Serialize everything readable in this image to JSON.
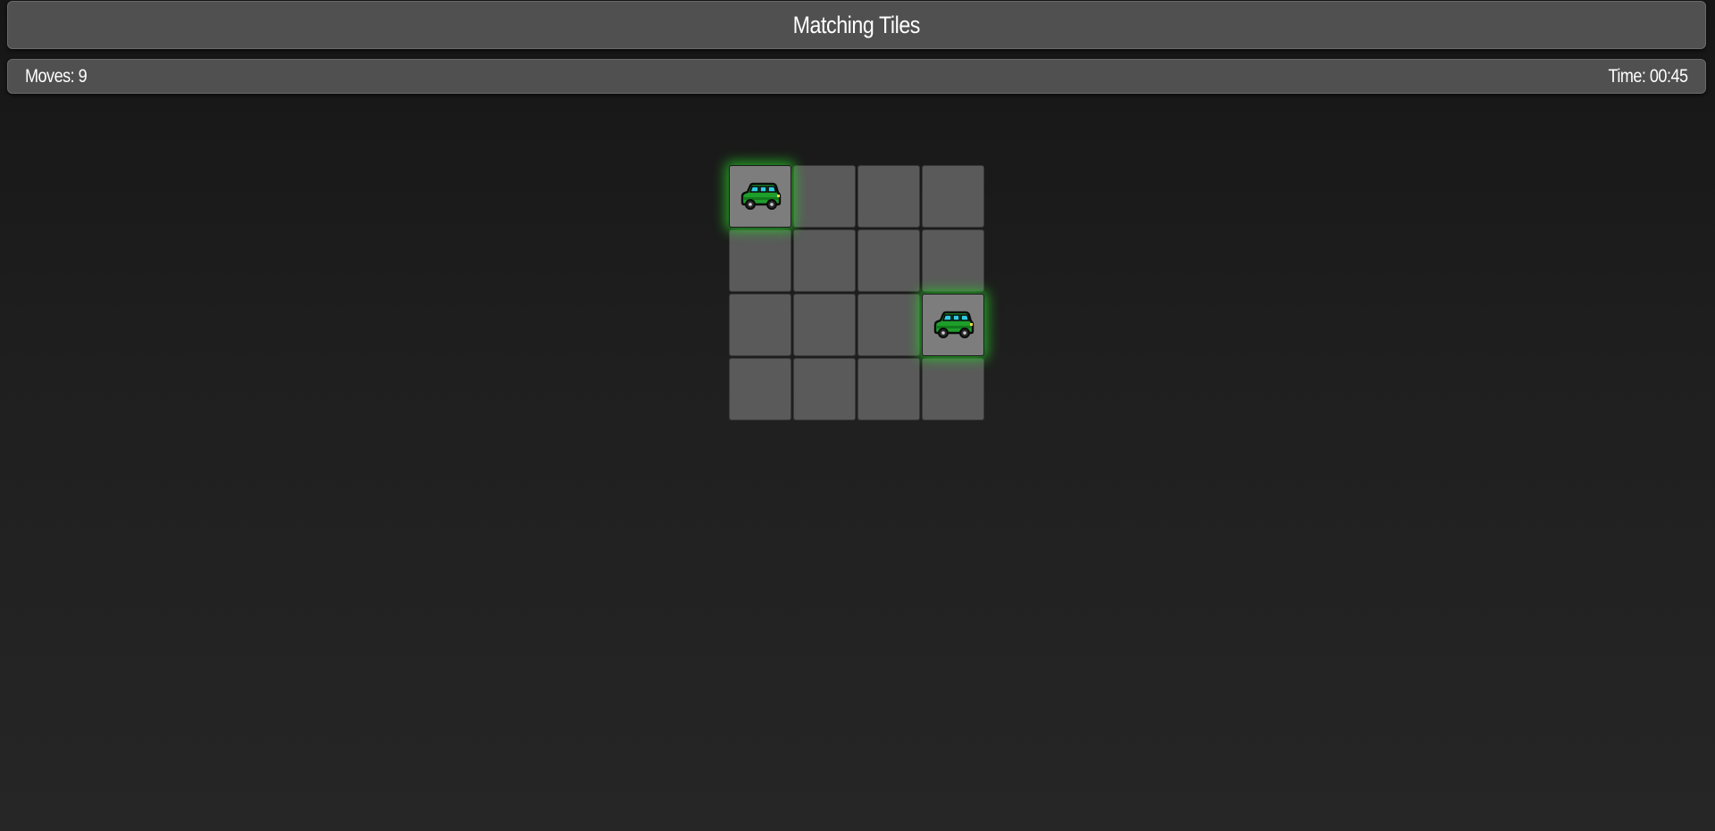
{
  "header": {
    "title": "Matching Tiles"
  },
  "stats": {
    "moves_label": "Moves: 9",
    "time_label": "Time: 00:45"
  },
  "board": {
    "rows": 4,
    "cols": 4,
    "tiles": [
      {
        "state": "revealed",
        "icon": "suv-car-icon"
      },
      {
        "state": "hidden",
        "icon": ""
      },
      {
        "state": "hidden",
        "icon": ""
      },
      {
        "state": "hidden",
        "icon": ""
      },
      {
        "state": "hidden",
        "icon": ""
      },
      {
        "state": "hidden",
        "icon": ""
      },
      {
        "state": "hidden",
        "icon": ""
      },
      {
        "state": "hidden",
        "icon": ""
      },
      {
        "state": "hidden",
        "icon": ""
      },
      {
        "state": "hidden",
        "icon": ""
      },
      {
        "state": "hidden",
        "icon": ""
      },
      {
        "state": "revealed",
        "icon": "suv-car-icon"
      },
      {
        "state": "hidden",
        "icon": ""
      },
      {
        "state": "hidden",
        "icon": ""
      },
      {
        "state": "hidden",
        "icon": ""
      },
      {
        "state": "hidden",
        "icon": ""
      }
    ]
  },
  "colors": {
    "background": "#1f1f1f",
    "panel": "#505050",
    "tile_hidden": "#5a5a5a",
    "tile_revealed": "#7d7d7d",
    "match_glow": "#28c828"
  }
}
